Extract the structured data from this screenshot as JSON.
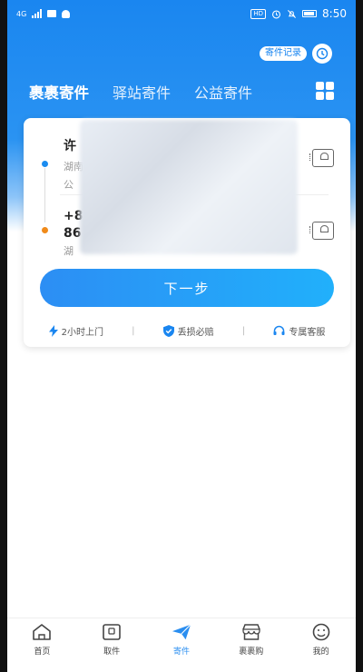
{
  "status_bar": {
    "network": "4G",
    "hd": "HD",
    "time": "8:50"
  },
  "header": {
    "record_label": "寄件记录"
  },
  "tabs": [
    {
      "label": "裹裹寄件",
      "active": true
    },
    {
      "label": "驿站寄件",
      "active": false
    },
    {
      "label": "公益寄件",
      "active": false
    }
  ],
  "sender": {
    "name": "许",
    "line1": "湖南",
    "line2": "公"
  },
  "receiver": {
    "name": "+8",
    "phone": "86",
    "line": "湖"
  },
  "next_button": "下一步",
  "features": [
    {
      "label": "2小时上门",
      "icon": "lightning-icon"
    },
    {
      "label": "丢损必赔",
      "icon": "shield-check-icon"
    },
    {
      "label": "专属客服",
      "icon": "headset-icon"
    }
  ],
  "bottom_nav": [
    {
      "label": "首页",
      "icon": "home-icon",
      "active": false
    },
    {
      "label": "取件",
      "icon": "pickup-icon",
      "active": false
    },
    {
      "label": "寄件",
      "icon": "paper-plane-icon",
      "active": true
    },
    {
      "label": "裹裹购",
      "icon": "shop-icon",
      "active": false
    },
    {
      "label": "我的",
      "icon": "profile-icon",
      "active": false
    }
  ],
  "colors": {
    "primary": "#1a86f0",
    "sender_dot": "#1a8cf0",
    "receiver_dot": "#f08a1a"
  }
}
